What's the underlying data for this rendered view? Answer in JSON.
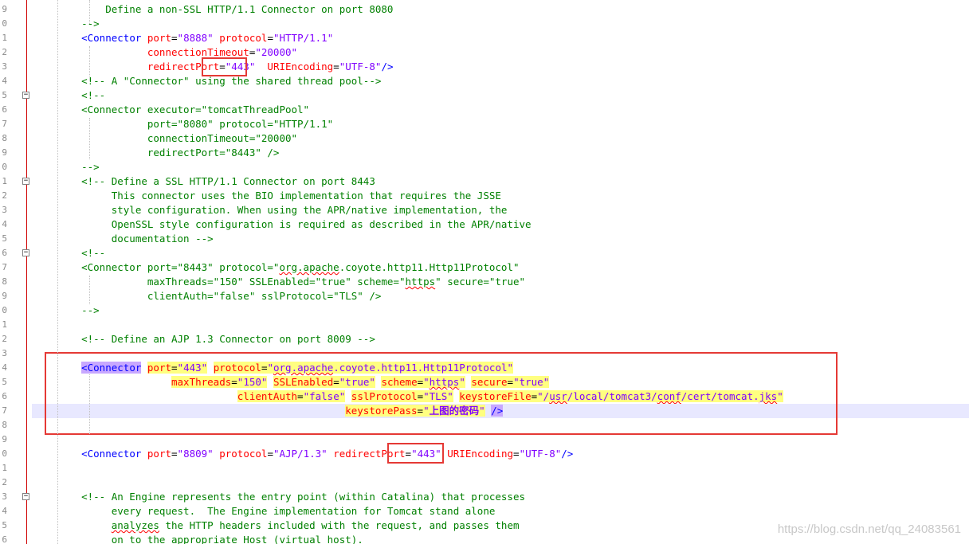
{
  "editor": {
    "lines": [
      {
        "num": "9",
        "code": [
          {
            "t": "        Define a non-SSL HTTP/1.1 Connector on port 8080",
            "c": "cm"
          }
        ]
      },
      {
        "num": "0",
        "code": [
          {
            "t": "    -->",
            "c": "cm"
          }
        ]
      },
      {
        "num": "1",
        "code": [
          {
            "t": "    ",
            "c": "sp"
          },
          {
            "t": "<Connector ",
            "c": "tag"
          },
          {
            "t": "port",
            "c": "attr"
          },
          {
            "t": "=",
            "c": "eq"
          },
          {
            "t": "\"8888\"",
            "c": "val"
          },
          {
            "t": " protocol",
            "c": "attr"
          },
          {
            "t": "=",
            "c": "eq"
          },
          {
            "t": "\"HTTP/1.1\"",
            "c": "val"
          }
        ]
      },
      {
        "num": "2",
        "code": [
          {
            "t": "               connectionTimeout",
            "c": "attr"
          },
          {
            "t": "=",
            "c": "eq"
          },
          {
            "t": "\"20000\"",
            "c": "val"
          }
        ]
      },
      {
        "num": "3",
        "code": [
          {
            "t": "               redirectPort",
            "c": "attr"
          },
          {
            "t": "=",
            "c": "eq"
          },
          {
            "t": "\"443\"",
            "c": "val"
          },
          {
            "t": "  URIEncoding",
            "c": "attr"
          },
          {
            "t": "=",
            "c": "eq"
          },
          {
            "t": "\"UTF-8\"",
            "c": "val"
          },
          {
            "t": "/>",
            "c": "tag"
          }
        ]
      },
      {
        "num": "4",
        "code": [
          {
            "t": "    <!-- A \"Connector\" using the shared thread pool-->",
            "c": "cm"
          }
        ]
      },
      {
        "num": "5",
        "fold": true,
        "code": [
          {
            "t": "    <!--",
            "c": "cm"
          }
        ]
      },
      {
        "num": "6",
        "code": [
          {
            "t": "    <Connector executor=\"tomcatThreadPool\"",
            "c": "cm"
          }
        ]
      },
      {
        "num": "7",
        "code": [
          {
            "t": "               port=\"8080\" protocol=\"HTTP/1.1\"",
            "c": "cm"
          }
        ]
      },
      {
        "num": "8",
        "code": [
          {
            "t": "               connectionTimeout=\"20000\"",
            "c": "cm"
          }
        ]
      },
      {
        "num": "9",
        "code": [
          {
            "t": "               redirectPort=\"8443\" />",
            "c": "cm"
          }
        ]
      },
      {
        "num": "0",
        "code": [
          {
            "t": "    -->",
            "c": "cm"
          }
        ]
      },
      {
        "num": "1",
        "fold": true,
        "code": [
          {
            "t": "    <!-- Define a SSL HTTP/1.1 Connector on port 8443",
            "c": "cm"
          }
        ]
      },
      {
        "num": "2",
        "code": [
          {
            "t": "         This connector uses the BIO implementation that requires the JSSE",
            "c": "cm"
          }
        ]
      },
      {
        "num": "3",
        "code": [
          {
            "t": "         style configuration. When using the APR/native implementation, the",
            "c": "cm"
          }
        ]
      },
      {
        "num": "4",
        "code": [
          {
            "t": "         OpenSSL style configuration is required as described in the APR/native",
            "c": "cm"
          }
        ]
      },
      {
        "num": "5",
        "code": [
          {
            "t": "         documentation -->",
            "c": "cm"
          }
        ]
      },
      {
        "num": "6",
        "fold": true,
        "code": [
          {
            "t": "    <!--",
            "c": "cm"
          }
        ]
      },
      {
        "num": "7",
        "code": [
          {
            "t": "    <Connector port=\"8443\" protocol=\"",
            "c": "cm"
          },
          {
            "t": "org.apache",
            "c": "cm squig"
          },
          {
            "t": ".coyote.http11.Http11Protocol\"",
            "c": "cm"
          }
        ]
      },
      {
        "num": "8",
        "code": [
          {
            "t": "               maxThreads=\"150\" SSLEnabled=\"true\" scheme=\"",
            "c": "cm"
          },
          {
            "t": "https",
            "c": "cm squig"
          },
          {
            "t": "\" secure=\"true\"",
            "c": "cm"
          }
        ]
      },
      {
        "num": "9",
        "code": [
          {
            "t": "               clientAuth=\"false\" sslProtocol=\"TLS\" />",
            "c": "cm"
          }
        ]
      },
      {
        "num": "0",
        "code": [
          {
            "t": "    -->",
            "c": "cm"
          }
        ]
      },
      {
        "num": "1",
        "code": [
          {
            "t": "",
            "c": "cm"
          }
        ]
      },
      {
        "num": "2",
        "code": [
          {
            "t": "    <!-- Define an AJP 1.3 Connector on port 8009 -->",
            "c": "cm"
          }
        ]
      },
      {
        "num": "3",
        "code": [
          {
            "t": "",
            "c": "cm"
          }
        ]
      },
      {
        "num": "4",
        "code": [
          {
            "t": "    ",
            "c": "sp"
          },
          {
            "t": "<Connector",
            "c": "tag hltag"
          },
          {
            "t": " ",
            "c": "sp"
          },
          {
            "t": "port",
            "c": "attr hl"
          },
          {
            "t": "=",
            "c": "eq hl"
          },
          {
            "t": "\"443\"",
            "c": "val hl"
          },
          {
            "t": " ",
            "c": "sp"
          },
          {
            "t": "protocol",
            "c": "attr hl"
          },
          {
            "t": "=",
            "c": "eq hl"
          },
          {
            "t": "\"",
            "c": "val hl"
          },
          {
            "t": "org.apache",
            "c": "val hl squig"
          },
          {
            "t": ".coyote.http11.Http11Protocol\"",
            "c": "val hl"
          }
        ]
      },
      {
        "num": "5",
        "code": [
          {
            "t": "                   ",
            "c": "sp"
          },
          {
            "t": "maxThreads",
            "c": "attr hl"
          },
          {
            "t": "=",
            "c": "eq hl"
          },
          {
            "t": "\"150\"",
            "c": "val hl"
          },
          {
            "t": " ",
            "c": "sp"
          },
          {
            "t": "SSLEnabled",
            "c": "attr hl"
          },
          {
            "t": "=",
            "c": "eq hl"
          },
          {
            "t": "\"true\"",
            "c": "val hl"
          },
          {
            "t": " ",
            "c": "sp"
          },
          {
            "t": "scheme",
            "c": "attr hl"
          },
          {
            "t": "=",
            "c": "eq hl"
          },
          {
            "t": "\"",
            "c": "val hl"
          },
          {
            "t": "https",
            "c": "val hl squig"
          },
          {
            "t": "\"",
            "c": "val hl"
          },
          {
            "t": " ",
            "c": "sp"
          },
          {
            "t": "secure",
            "c": "attr hl"
          },
          {
            "t": "=",
            "c": "eq hl"
          },
          {
            "t": "\"true\"",
            "c": "val hl"
          }
        ]
      },
      {
        "num": "6",
        "code": [
          {
            "t": "                              ",
            "c": "sp"
          },
          {
            "t": "clientAuth",
            "c": "attr hl"
          },
          {
            "t": "=",
            "c": "eq hl"
          },
          {
            "t": "\"false\"",
            "c": "val hl"
          },
          {
            "t": " ",
            "c": "sp"
          },
          {
            "t": "sslProtocol",
            "c": "attr hl"
          },
          {
            "t": "=",
            "c": "eq hl"
          },
          {
            "t": "\"TLS\"",
            "c": "val hl"
          },
          {
            "t": " ",
            "c": "sp"
          },
          {
            "t": "keystoreFile",
            "c": "attr hl"
          },
          {
            "t": "=",
            "c": "eq hl"
          },
          {
            "t": "\"/",
            "c": "val hl"
          },
          {
            "t": "usr",
            "c": "val hl squig"
          },
          {
            "t": "/local/tomcat3/",
            "c": "val hl"
          },
          {
            "t": "conf",
            "c": "val hl squig"
          },
          {
            "t": "/cert/tomcat.",
            "c": "val hl"
          },
          {
            "t": "jks",
            "c": "val hl squig"
          },
          {
            "t": "\"",
            "c": "val hl"
          }
        ]
      },
      {
        "num": "7",
        "current": true,
        "code": [
          {
            "t": "                                                ",
            "c": "sp"
          },
          {
            "t": "keystorePass",
            "c": "attr hl"
          },
          {
            "t": "=",
            "c": "eq hl"
          },
          {
            "t": "\"",
            "c": "val hl"
          },
          {
            "t": "上图的密码",
            "c": "val hl bold"
          },
          {
            "t": "\"",
            "c": "val hl"
          },
          {
            "t": " ",
            "c": "sp"
          },
          {
            "t": "/>",
            "c": "tag hltag"
          }
        ]
      },
      {
        "num": "8",
        "code": [
          {
            "t": "",
            "c": "sp"
          }
        ]
      },
      {
        "num": "9",
        "code": [
          {
            "t": "",
            "c": "sp"
          }
        ]
      },
      {
        "num": "0",
        "code": [
          {
            "t": "    ",
            "c": "sp"
          },
          {
            "t": "<Connector ",
            "c": "tag"
          },
          {
            "t": "port",
            "c": "attr"
          },
          {
            "t": "=",
            "c": "eq"
          },
          {
            "t": "\"8809\"",
            "c": "val"
          },
          {
            "t": " protocol",
            "c": "attr"
          },
          {
            "t": "=",
            "c": "eq"
          },
          {
            "t": "\"AJP/1.3\"",
            "c": "val"
          },
          {
            "t": " redirectPort",
            "c": "attr"
          },
          {
            "t": "=",
            "c": "eq"
          },
          {
            "t": "\"443\"",
            "c": "val"
          },
          {
            "t": " URIEncoding",
            "c": "attr"
          },
          {
            "t": "=",
            "c": "eq"
          },
          {
            "t": "\"UTF-8\"",
            "c": "val"
          },
          {
            "t": "/>",
            "c": "tag"
          }
        ]
      },
      {
        "num": "1",
        "code": [
          {
            "t": "",
            "c": "sp"
          }
        ]
      },
      {
        "num": "2",
        "code": [
          {
            "t": "",
            "c": "sp"
          }
        ]
      },
      {
        "num": "3",
        "fold": true,
        "code": [
          {
            "t": "    <!-- An Engine represents the entry point (within Catalina) that processes",
            "c": "cm"
          }
        ]
      },
      {
        "num": "4",
        "code": [
          {
            "t": "         every request.  The Engine implementation for Tomcat stand alone",
            "c": "cm"
          }
        ]
      },
      {
        "num": "5",
        "code": [
          {
            "t": "         ",
            "c": "cm"
          },
          {
            "t": "analyzes",
            "c": "cm squig"
          },
          {
            "t": " the HTTP headers included with the request, and passes them",
            "c": "cm"
          }
        ]
      },
      {
        "num": "6",
        "code": [
          {
            "t": "         on to the appropriate Host (virtual host).",
            "c": "cm"
          }
        ]
      }
    ],
    "fold_symbol": "−",
    "watermark": "https://blog.csdn.net/qq_24083561"
  }
}
